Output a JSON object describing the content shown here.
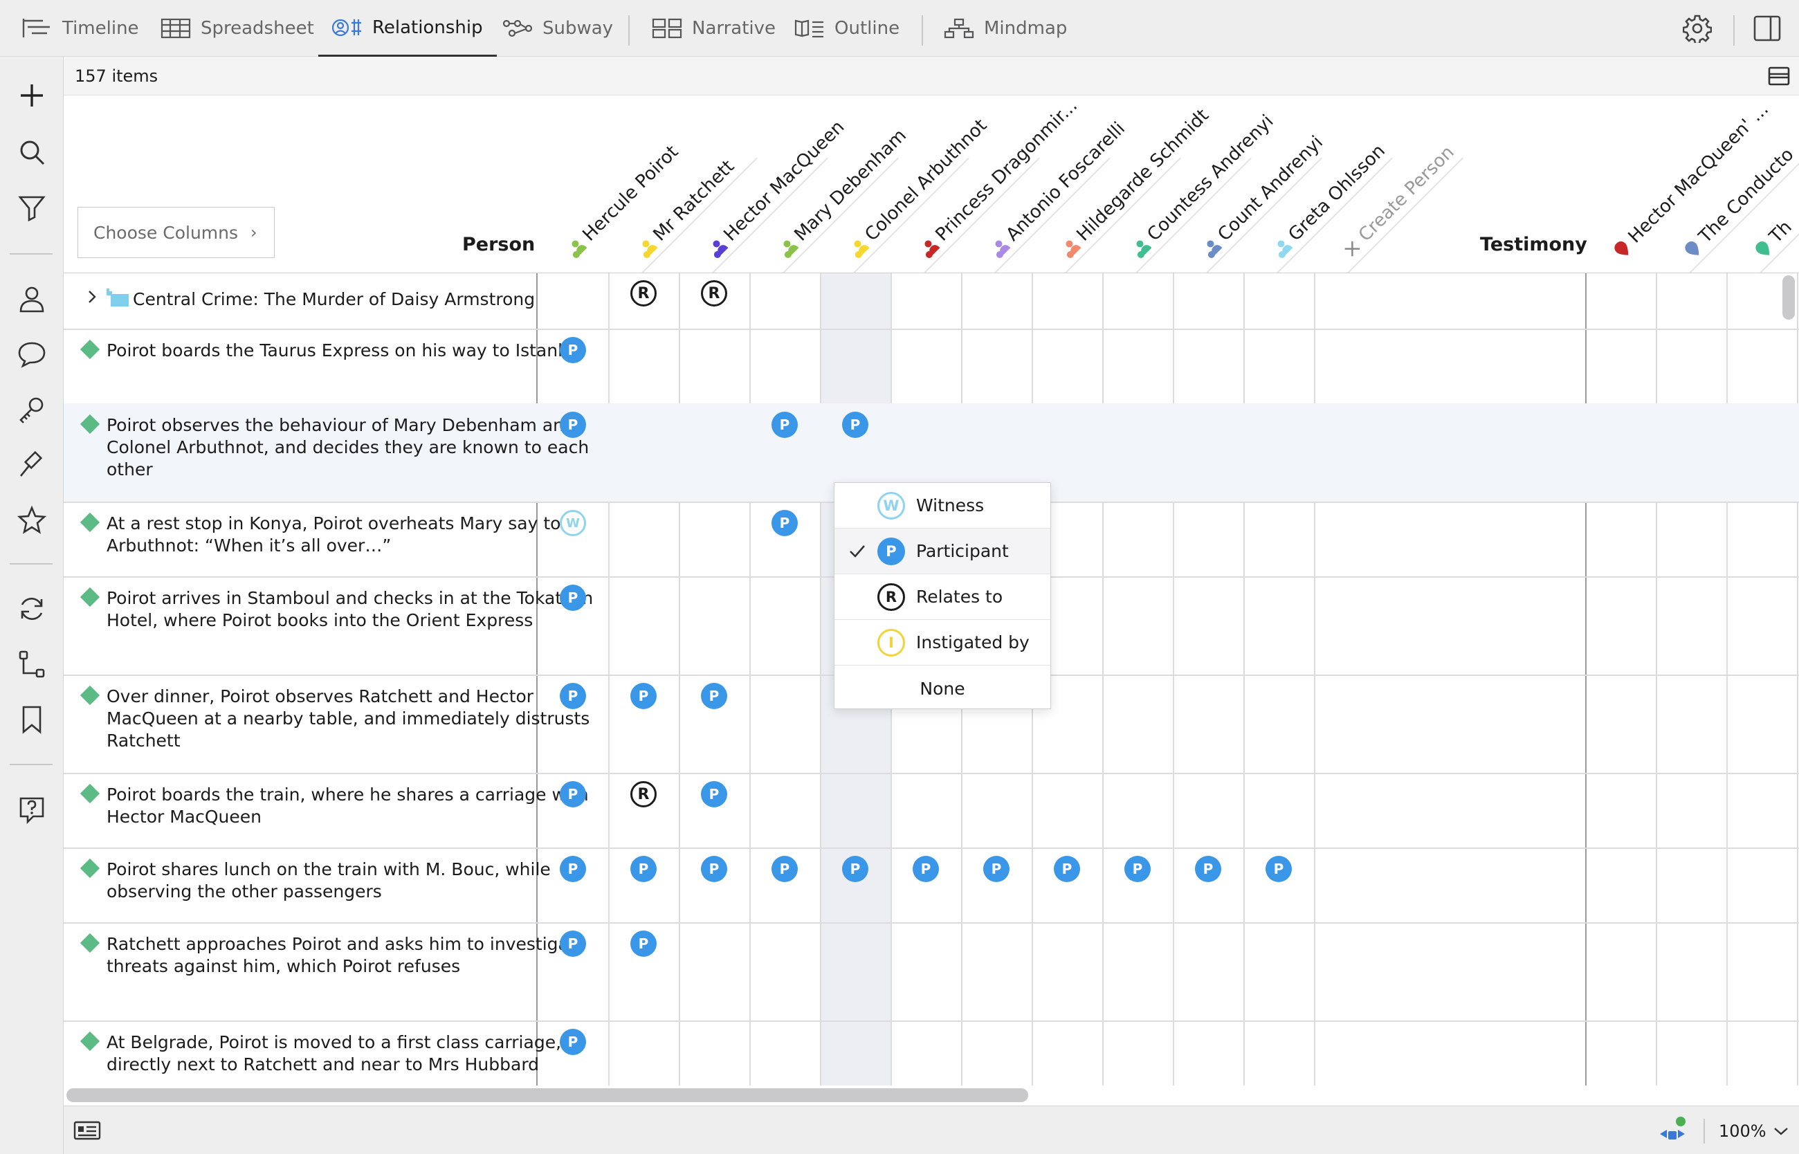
{
  "view_tabs": [
    {
      "label": "Timeline"
    },
    {
      "label": "Spreadsheet"
    },
    {
      "label": "Relationship"
    },
    {
      "label": "Subway"
    },
    {
      "label": "Narrative"
    },
    {
      "label": "Outline"
    },
    {
      "label": "Mindmap"
    }
  ],
  "active_view": "Relationship",
  "count_label": "157 items",
  "choose_columns_label": "Choose Columns",
  "groups": {
    "person": "Person",
    "testimony": "Testimony"
  },
  "person_columns": [
    {
      "label": "Hercule Poirot",
      "color": "#8bc34a"
    },
    {
      "label": "Mr Ratchett",
      "color": "#f5d730"
    },
    {
      "label": "Hector MacQueen",
      "color": "#5a3fd6"
    },
    {
      "label": "Mary Debenham",
      "color": "#8bc34a"
    },
    {
      "label": "Colonel Arbuthnot",
      "color": "#f5d730"
    },
    {
      "label": "Princess Dragonmir...",
      "color": "#c62828"
    },
    {
      "label": "Antonio Foscarelli",
      "color": "#a98ae6"
    },
    {
      "label": "Hildegarde Schmidt",
      "color": "#f08a6a"
    },
    {
      "label": "Countess Andrenyi",
      "color": "#3fbf8f"
    },
    {
      "label": "Count Andrenyi",
      "color": "#6b8cc7"
    },
    {
      "label": "Greta Ohlsson",
      "color": "#90d8f0"
    }
  ],
  "create_person_label": "Create Person",
  "testimony_columns": [
    {
      "label": "Hector MacQueen' ...",
      "color": "#c62828"
    },
    {
      "label": "The Conducto",
      "color": "#6b8cc7"
    },
    {
      "label": "Th",
      "color": "#3fbf8f"
    }
  ],
  "rows": [
    {
      "text": "Central Crime: The Murder of Daisy Armstrong",
      "cells": [
        "",
        "R",
        "R",
        "",
        "",
        "",
        "",
        "",
        "",
        "",
        ""
      ]
    },
    {
      "text": "Poirot boards the Taurus Express on his way to Istanbul",
      "cells": [
        "P",
        "",
        "",
        "",
        "",
        "",
        "",
        "",
        "",
        "",
        ""
      ]
    },
    {
      "text": "Poirot observes the behaviour of Mary Debenham and Colonel Arbuthnot, and decides they are known to each other",
      "cells": [
        "P",
        "",
        "",
        "P",
        "P",
        "",
        "",
        "",
        "",
        "",
        ""
      ]
    },
    {
      "text": "At a rest stop in Konya, Poirot overheats Mary say to Arbuthnot: “When it’s all over…”",
      "cells": [
        "W",
        "",
        "",
        "P",
        "",
        "",
        "",
        "",
        "",
        "",
        ""
      ]
    },
    {
      "text": "Poirot arrives in Stamboul and checks in at the Tokatlian Hotel, where Poirot books into the Orient Express",
      "cells": [
        "P",
        "",
        "",
        "",
        "",
        "",
        "",
        "",
        "",
        "",
        ""
      ]
    },
    {
      "text": "Over dinner, Poirot observes Ratchett and Hector MacQueen at a nearby table, and immediately distrusts Ratchett",
      "cells": [
        "P",
        "P",
        "P",
        "",
        "",
        "",
        "",
        "",
        "",
        "",
        ""
      ]
    },
    {
      "text": "Poirot boards the train, where he shares a carriage with Hector MacQueen",
      "cells": [
        "P",
        "R",
        "P",
        "",
        "",
        "",
        "",
        "",
        "",
        "",
        ""
      ]
    },
    {
      "text": "Poirot shares lunch on the train with M. Bouc, while observing the other passengers",
      "cells": [
        "P",
        "P",
        "P",
        "P",
        "P",
        "P",
        "P",
        "P",
        "P",
        "P",
        "P"
      ]
    },
    {
      "text": "Ratchett approaches Poirot and asks him to investigate threats against him, which Poirot refuses",
      "cells": [
        "P",
        "P",
        "",
        "",
        "",
        "",
        "",
        "",
        "",
        "",
        ""
      ]
    },
    {
      "text": "At Belgrade, Poirot is moved to a first class carriage, directly next to Ratchett and near to Mrs Hubbard",
      "cells": [
        "P",
        "",
        "",
        "",
        "",
        "",
        "",
        "",
        "",
        "",
        ""
      ]
    }
  ],
  "badge_letters": {
    "P": "P",
    "W": "W",
    "R": "R",
    "I": "I"
  },
  "relationship_menu": {
    "items": [
      {
        "key": "W",
        "label": "Witness",
        "color": "#8fd3f0",
        "selected": false
      },
      {
        "key": "P",
        "label": "Participant",
        "color": "#3a97e8",
        "selected": true
      },
      {
        "key": "R",
        "label": "Relates to",
        "color": "#1c1c1c",
        "selected": false
      },
      {
        "key": "I",
        "label": "Instigated by",
        "color": "#f0d43a",
        "selected": false
      }
    ],
    "none_label": "None"
  },
  "zoom_label": "100%",
  "colors": {
    "accent": "#3a97e8",
    "event_diamond": "#5cba84",
    "sync_dot": "#4caf50"
  }
}
